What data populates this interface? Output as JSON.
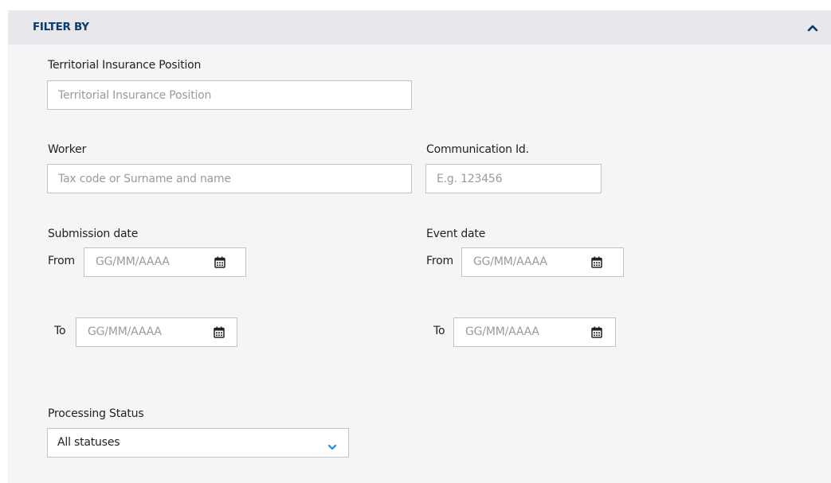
{
  "filter": {
    "title": "FILTER BY",
    "collapse_icon": "chevron-up-icon"
  },
  "fields": {
    "territorial_label": "Territorial Insurance Position",
    "territorial_placeholder": "Territorial Insurance Position",
    "worker_label": "Worker",
    "worker_placeholder": "Tax code or Surname and name",
    "communication_label": "Communication Id.",
    "communication_placeholder": "E.g. 123456",
    "submission_label": "Submission date",
    "event_label": "Event date",
    "from_label": "From",
    "to_label": "To",
    "date_placeholder": "GG/MM/AAAA",
    "calendar_icon": "calendar-icon",
    "status_label": "Processing Status",
    "status_value": "All statuses",
    "status_icon": "chevron-down-icon"
  },
  "colors": {
    "title": "#0b3a6e",
    "accent": "#1a8be0",
    "panel_bg": "#f5f5f7",
    "header_bg": "#e8e8ec",
    "border": "#c4c4c4"
  }
}
